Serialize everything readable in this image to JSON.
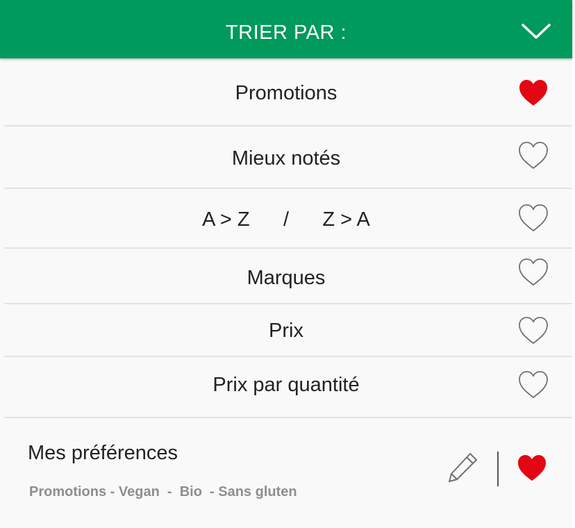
{
  "header": {
    "title": "TRIER PAR :",
    "chevron_icon": "chevron-down-icon",
    "background": "#009a5c"
  },
  "sort_options": [
    {
      "label": "Promotions",
      "favorite": true
    },
    {
      "label": "Mieux notés",
      "favorite": false
    },
    {
      "label": "A > Z      /      Z > A",
      "favorite": false
    },
    {
      "label": "Marques",
      "favorite": false
    },
    {
      "label": "Prix",
      "favorite": false
    },
    {
      "label": "Prix par quantité",
      "favorite": false
    }
  ],
  "preferences": {
    "title": "Mes préférences",
    "subtitle": "Promotions - Vegan  -  Bio  - Sans gluten",
    "favorite": true,
    "edit_icon": "pencil-icon"
  },
  "colors": {
    "accent": "#009a5c",
    "heart_active": "#e30613",
    "heart_inactive": "#707070"
  }
}
